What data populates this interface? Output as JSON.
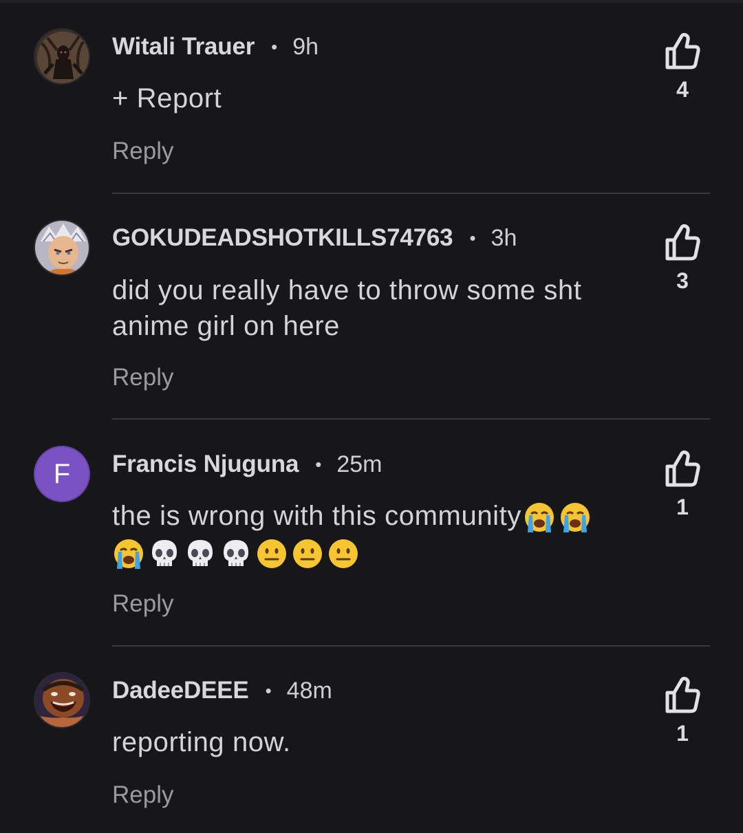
{
  "comments": [
    {
      "author": "Witali Trauer",
      "separator": "•",
      "time": "9h",
      "text": "+ Report",
      "reply_label": "Reply",
      "likes": "4",
      "avatar": "dark-creature-avatar"
    },
    {
      "author": "GOKUDEADSHOTKILLS74763",
      "separator": "•",
      "time": "3h",
      "text": "did you really have to throw some sht anime girl on here",
      "reply_label": "Reply",
      "likes": "3",
      "avatar": "anime-character-avatar"
    },
    {
      "author": "Francis Njuguna",
      "separator": "•",
      "time": "25m",
      "text": "the is wrong with this community",
      "emojis": [
        "crying-face",
        "crying-face",
        "crying-face",
        "skull",
        "skull",
        "skull",
        "neutral-face",
        "neutral-face",
        "neutral-face"
      ],
      "avatar_letter": "F",
      "reply_label": "Reply",
      "likes": "1",
      "avatar_color": "#7b52c4"
    },
    {
      "author": "DadeeDEEE",
      "separator": "•",
      "time": "48m",
      "text": "reporting now.",
      "reply_label": "Reply",
      "likes": "1",
      "avatar": "cartoon-face-avatar"
    }
  ],
  "colors": {
    "background": "#171719",
    "divider": "#3a3a3e",
    "text": "#d4d4d7",
    "muted": "#9a9a9f"
  }
}
